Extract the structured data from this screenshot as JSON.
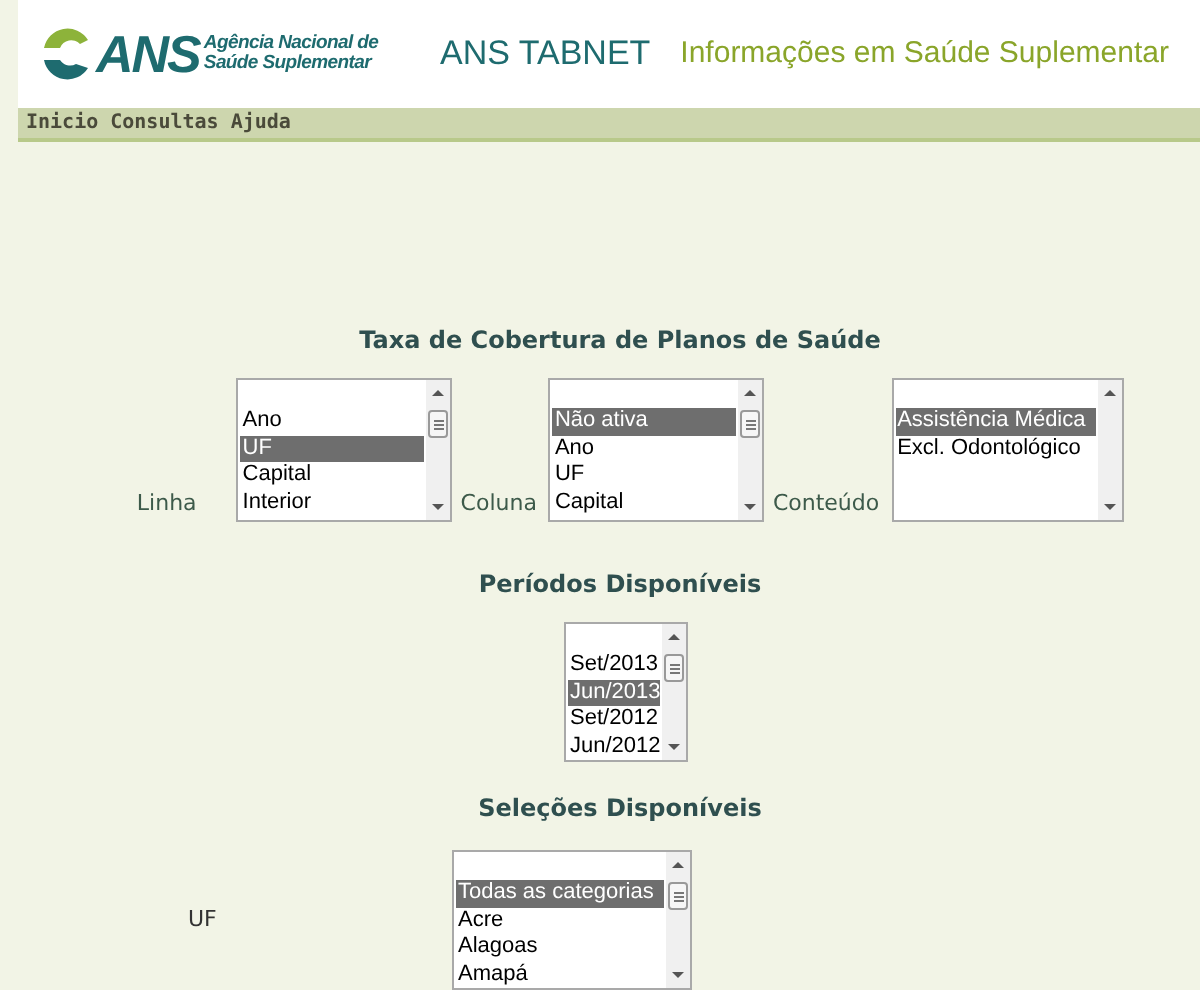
{
  "header": {
    "logo_letters": "ANS",
    "logo_agency": "Agência Nacional de",
    "logo_agency_2": "Saúde Suplementar",
    "title": "ANS TABNET",
    "subtitle": "Informações em Saúde Suplementar"
  },
  "menu": [
    {
      "label": "Inicio"
    },
    {
      "label": "Consultas"
    },
    {
      "label": "Ajuda"
    }
  ],
  "form_title": "Taxa de Cobertura de Planos de Saúde",
  "selectors": [
    {
      "label": "Linha",
      "scroll_thumb": true,
      "items": [
        {
          "label": "Ano",
          "selected": false
        },
        {
          "label": "UF",
          "selected": true
        },
        {
          "label": "Capital",
          "selected": false
        },
        {
          "label": "Interior",
          "selected": false
        }
      ]
    },
    {
      "label": "Coluna",
      "scroll_thumb": true,
      "items": [
        {
          "label": "Não ativa",
          "selected": true
        },
        {
          "label": "Ano",
          "selected": false
        },
        {
          "label": "UF",
          "selected": false
        },
        {
          "label": "Capital",
          "selected": false
        }
      ]
    },
    {
      "label": "Conteúdo",
      "scroll_thumb": false,
      "items": [
        {
          "label": "Assistência Médica",
          "selected": true
        },
        {
          "label": "Excl. Odontológico",
          "selected": false
        }
      ]
    }
  ],
  "periods": {
    "title": "Períodos Disponíveis",
    "items": [
      {
        "label": "Set/2013",
        "selected": false
      },
      {
        "label": "Jun/2013",
        "selected": true
      },
      {
        "label": "Set/2012",
        "selected": false
      },
      {
        "label": "Jun/2012",
        "selected": false
      }
    ]
  },
  "selections": {
    "title": "Seleções Disponíveis",
    "label": "UF",
    "items": [
      {
        "label": "Todas as categorias",
        "selected": true
      },
      {
        "label": "Acre",
        "selected": false
      },
      {
        "label": "Alagoas",
        "selected": false
      },
      {
        "label": "Amapá",
        "selected": false
      }
    ]
  }
}
